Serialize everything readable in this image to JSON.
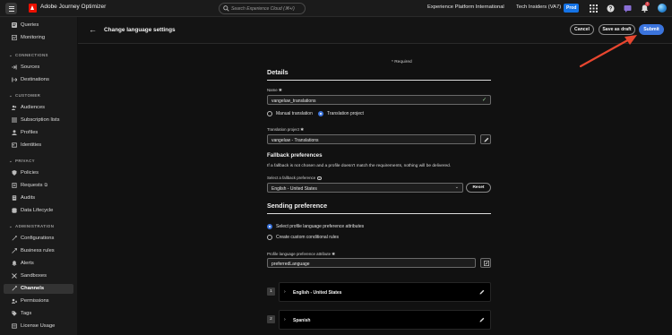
{
  "topbar": {
    "app_title": "Adobe Journey Optimizer",
    "search_placeholder": "Search Experience Cloud (⌘+/)",
    "org_name": "Experience Platform International",
    "sandbox_name": "Tech Insiders (VA7)",
    "env_badge": "Prod",
    "notification_count": "2"
  },
  "sidebar": {
    "items_top": [
      {
        "label": "Queries",
        "icon": "queries-icon"
      },
      {
        "label": "Monitoring",
        "icon": "monitoring-icon"
      }
    ],
    "sections": [
      {
        "title": "CONNECTIONS",
        "items": [
          {
            "label": "Sources"
          },
          {
            "label": "Destinations"
          }
        ]
      },
      {
        "title": "CUSTOMER",
        "items": [
          {
            "label": "Audiences"
          },
          {
            "label": "Subscription lists"
          },
          {
            "label": "Profiles"
          },
          {
            "label": "Identities"
          }
        ]
      },
      {
        "title": "PRIVACY",
        "items": [
          {
            "label": "Policies"
          },
          {
            "label": "Requests"
          },
          {
            "label": "Audits"
          },
          {
            "label": "Data Lifecycle"
          }
        ]
      },
      {
        "title": "ADMINISTRATION",
        "items": [
          {
            "label": "Configurations"
          },
          {
            "label": "Business rules"
          },
          {
            "label": "Alerts"
          },
          {
            "label": "Sandboxes"
          },
          {
            "label": "Channels"
          },
          {
            "label": "Permissions"
          },
          {
            "label": "Tags"
          },
          {
            "label": "License Usage"
          }
        ]
      }
    ],
    "active": "Channels"
  },
  "header": {
    "title": "Change language settings",
    "cancel_label": "Cancel",
    "draft_label": "Save as draft",
    "submit_label": "Submit"
  },
  "form": {
    "required_note": "* Required",
    "details_title": "Details",
    "name_label": "Name",
    "name_value": "vangeluw_translations",
    "radio_manual": "Manual translation",
    "radio_project": "Translation project",
    "selected_radio": "Translation project",
    "project_label": "Translation project",
    "project_value": "vangeluw - Translations",
    "fallback_title": "Fallback preferences",
    "fallback_desc": "If a fallback is not chosen and a profile doesn't match the requirements, nothing will be delivered.",
    "fallback_select_label": "Select a fallback preference",
    "fallback_select_value": "English - United States",
    "reset_label": "Reset",
    "sending_title": "Sending preference",
    "radio_profile_attr": "Select profile language preference attributes",
    "radio_conditional": "Create custom conditional rules",
    "selected_sending": "Select profile language preference attributes",
    "attr_label": "Profile language preference attribute",
    "attr_value": "preferredLanguage",
    "languages": [
      {
        "num": "1",
        "name": "English - United States"
      },
      {
        "num": "2",
        "name": "Spanish"
      }
    ]
  },
  "colors": {
    "accent": "#3b74dd",
    "annotation_arrow": "#e8462f",
    "background": "#111111"
  }
}
